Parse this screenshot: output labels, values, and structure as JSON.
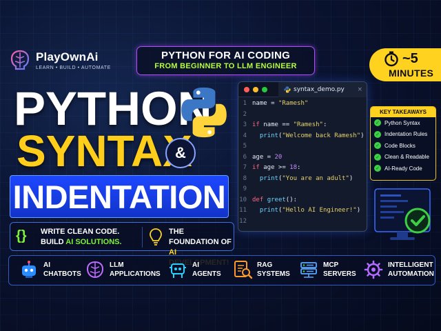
{
  "brand": {
    "name": "PlayOwnAi",
    "tagline": "LEARN • BUILD • AUTOMATE"
  },
  "banner": {
    "line1": "PYTHON FOR AI CODING",
    "line2": "FROM BEGINNER TO LLM ENGINEER"
  },
  "timer": {
    "value": "~5",
    "unit": "MINUTES"
  },
  "headline": {
    "word1": "PYTHON",
    "word2": "SYNTAX",
    "amp": "&",
    "word3": "INDENTATION"
  },
  "info": {
    "left_icon": "{}",
    "left_line1": "WRITE CLEAN CODE.",
    "left_line2_pre": "BUILD ",
    "left_line2_hl": "AI SOLUTIONS.",
    "right_line1": "THE FOUNDATION OF",
    "right_line2": "AI DEVELOPMENT!"
  },
  "code": {
    "filename": "syntax_demo.py",
    "close": "×",
    "line_numbers": [
      "1",
      "2",
      "3",
      "4",
      "5",
      "6",
      "7",
      "8",
      "9",
      "10",
      "11",
      "12"
    ]
  },
  "takeaways": {
    "title": "KEY TAKEAWAYS",
    "items": [
      "Python Syntax",
      "Indentation Rules",
      "Code Blocks",
      "Clean & Readable",
      "AI-Ready Code"
    ]
  },
  "bottom": {
    "items": [
      {
        "line1": "AI",
        "line2": "CHATBOTS",
        "icon": "robot-icon"
      },
      {
        "line1": "LLM",
        "line2": "APPLICATIONS",
        "icon": "brain-icon"
      },
      {
        "line1": "AI",
        "line2": "AGENTS",
        "icon": "agent-robot-icon"
      },
      {
        "line1": "RAG",
        "line2": "SYSTEMS",
        "icon": "document-search-icon"
      },
      {
        "line1": "MCP",
        "line2": "SERVERS",
        "icon": "server-icon"
      },
      {
        "line1": "INTELLIGENT",
        "line2": "AUTOMATION",
        "icon": "gear-icon"
      }
    ]
  },
  "colors": {
    "accent_yellow": "#ffd21f",
    "accent_green": "#7ef23a",
    "accent_blue": "#1d47ff",
    "banner_border": "#b44cff"
  }
}
